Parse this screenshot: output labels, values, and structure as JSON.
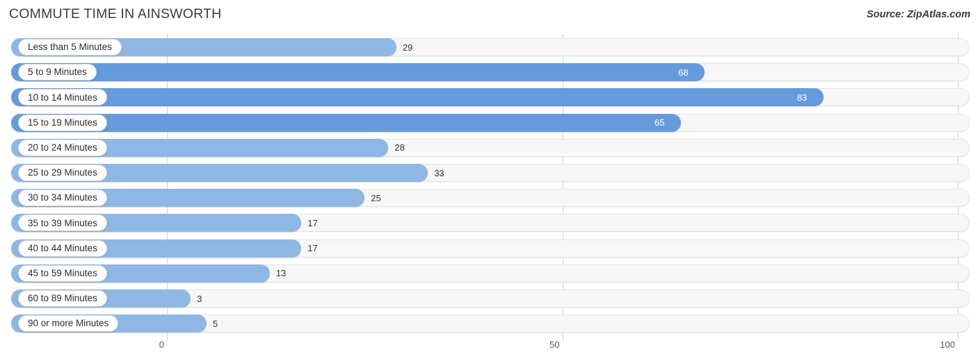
{
  "header": {
    "title": "COMMUTE TIME IN AINSWORTH",
    "source": "Source: ZipAtlas.com"
  },
  "colors": {
    "bar_light": "#8fb7e3",
    "bar_dark": "#659bdb",
    "track": "#f7f7f7",
    "gridline": "#d4d4d4",
    "label_text": "#2b2b2b"
  },
  "chart_data": {
    "type": "bar",
    "orientation": "horizontal",
    "title": "COMMUTE TIME IN AINSWORTH",
    "xlabel": "",
    "ylabel": "",
    "xlim": [
      0,
      100
    ],
    "xticks": [
      0,
      50,
      100
    ],
    "xtick_labels": [
      "0",
      "50",
      "100"
    ],
    "grid": true,
    "legend": "none",
    "categories": [
      "Less than 5 Minutes",
      "5 to 9 Minutes",
      "10 to 14 Minutes",
      "15 to 19 Minutes",
      "20 to 24 Minutes",
      "25 to 29 Minutes",
      "30 to 34 Minutes",
      "35 to 39 Minutes",
      "40 to 44 Minutes",
      "45 to 59 Minutes",
      "60 to 89 Minutes",
      "90 or more Minutes"
    ],
    "values": [
      29,
      68,
      83,
      65,
      28,
      33,
      25,
      17,
      17,
      13,
      3,
      5
    ],
    "value_labels": [
      "29",
      "68",
      "83",
      "65",
      "28",
      "33",
      "25",
      "17",
      "17",
      "13",
      "3",
      "5"
    ]
  }
}
